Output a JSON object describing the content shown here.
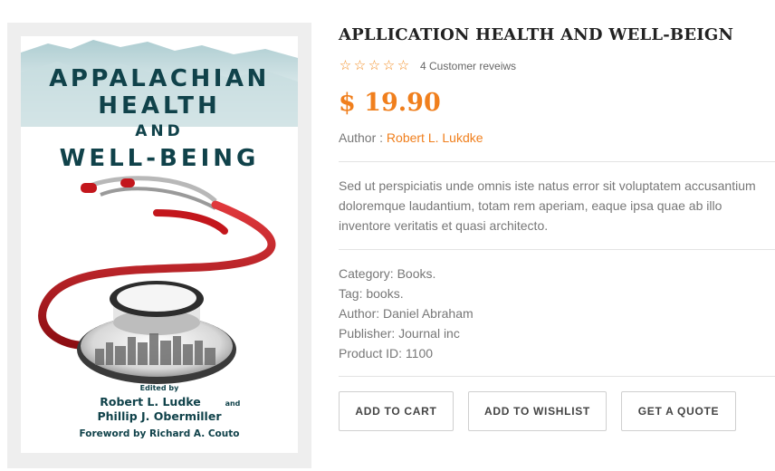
{
  "book_cover": {
    "title_lines": [
      "APPALACHIAN",
      "HEALTH",
      "AND",
      "WELL-BEING"
    ],
    "edited_by": "Edited by",
    "editor_1": "Robert L. Ludke",
    "and_word": "and",
    "editor_2": "Phillip J. Obermiller",
    "foreword": "Foreword by Richard A. Couto"
  },
  "product": {
    "title": "APLLICATION HEALTH AND WELL-BEIGN",
    "rating": 0,
    "rating_max": 5,
    "reviews_text": "4 Customer reveiws",
    "price": "$ 19.90",
    "author_label": "Author : ",
    "author_name": "Robert L. Lukdke",
    "description": "Sed ut perspiciatis unde omnis iste natus error sit voluptatem accusantium doloremque laudantium, totam rem aperiam, eaque ipsa quae ab illo inventore veritatis et quasi architecto.",
    "meta": {
      "category": "Category: Books.",
      "tag": "Tag: books.",
      "author": "Author: Daniel Abraham",
      "publisher": "Publisher: Journal inc",
      "product_id": "Product ID: 1100"
    }
  },
  "actions": {
    "add_to_cart": "ADD TO CART",
    "add_to_wishlist": "ADD TO WISHLIST",
    "get_a_quote": "GET A QUOTE"
  },
  "colors": {
    "accent": "#f07f1d",
    "star": "#f28a1e",
    "title": "#222222",
    "cover_title": "#10424a",
    "stethoscope_red": "#c3161c"
  }
}
